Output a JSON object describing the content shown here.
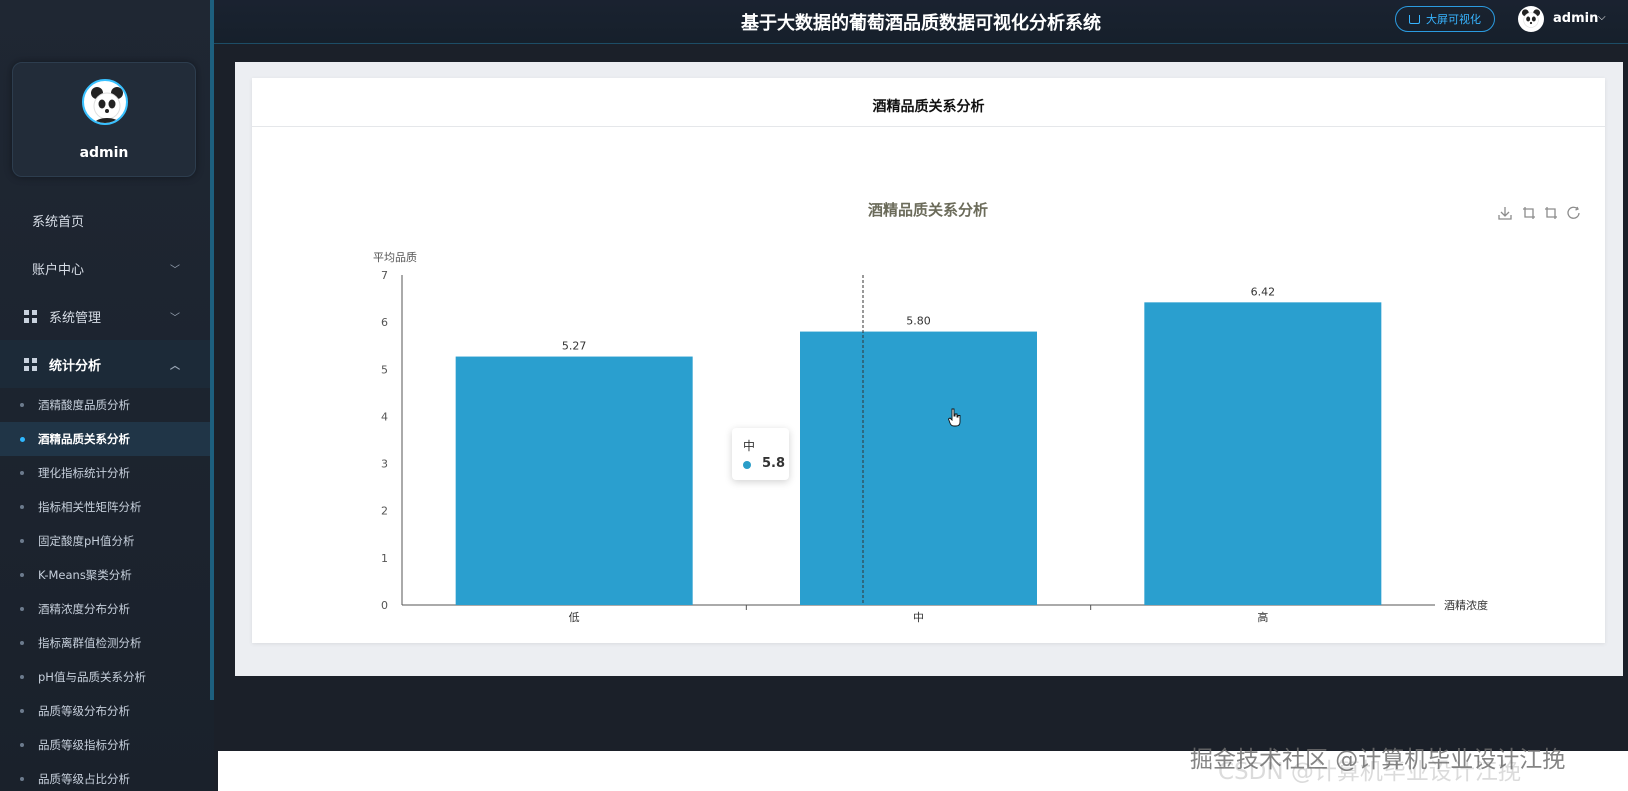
{
  "header": {
    "title": "基于大数据的葡萄酒品质数据可视化分析系统",
    "bigscreen_label": "大屏可视化",
    "username": "admin",
    "caret": "⌵"
  },
  "profile": {
    "name": "admin"
  },
  "menu": {
    "items": [
      {
        "label": "系统首页"
      },
      {
        "label": "账户中心",
        "chevron": "﹀"
      },
      {
        "label": "系统管理",
        "chevron": "﹀"
      },
      {
        "label": "统计分析",
        "chevron": "︿"
      }
    ],
    "submenu": [
      "酒精酸度品质分析",
      "酒精品质关系分析",
      "理化指标统计分析",
      "指标相关性矩阵分析",
      "固定酸度pH值分析",
      "K-Means聚类分析",
      "酒精浓度分布分析",
      "指标离群值检测分析",
      "pH值与品质关系分析",
      "品质等级分布分析",
      "品质等级指标分析",
      "品质等级占比分析"
    ],
    "active_submenu_index": 1
  },
  "card": {
    "title": "酒精品质关系分析"
  },
  "toolbox": [
    "download-icon",
    "zoom-icon",
    "zoom-reset-icon",
    "refresh-icon"
  ],
  "tooltip": {
    "name": "中",
    "value": "5.8"
  },
  "watermark": "掘金技术社区 @计算机毕业设计江挽",
  "watermark_under": "CSDN @计算机毕业设计江挽",
  "colors": {
    "bar": "#2a9fcf",
    "accent": "#2fb8ff",
    "sidebar_bg": "#1f2733"
  },
  "chart_data": {
    "type": "bar",
    "title": "酒精品质关系分析",
    "xlabel": "酒精浓度",
    "ylabel": "平均品质",
    "categories": [
      "低",
      "中",
      "高"
    ],
    "values": [
      5.27,
      5.8,
      6.42
    ],
    "value_labels": [
      "5.27",
      "5.80",
      "6.42"
    ],
    "ylim": [
      0,
      7
    ],
    "yticks": [
      0,
      1,
      2,
      3,
      4,
      5,
      6,
      7
    ],
    "grid": false,
    "legend": "none"
  }
}
